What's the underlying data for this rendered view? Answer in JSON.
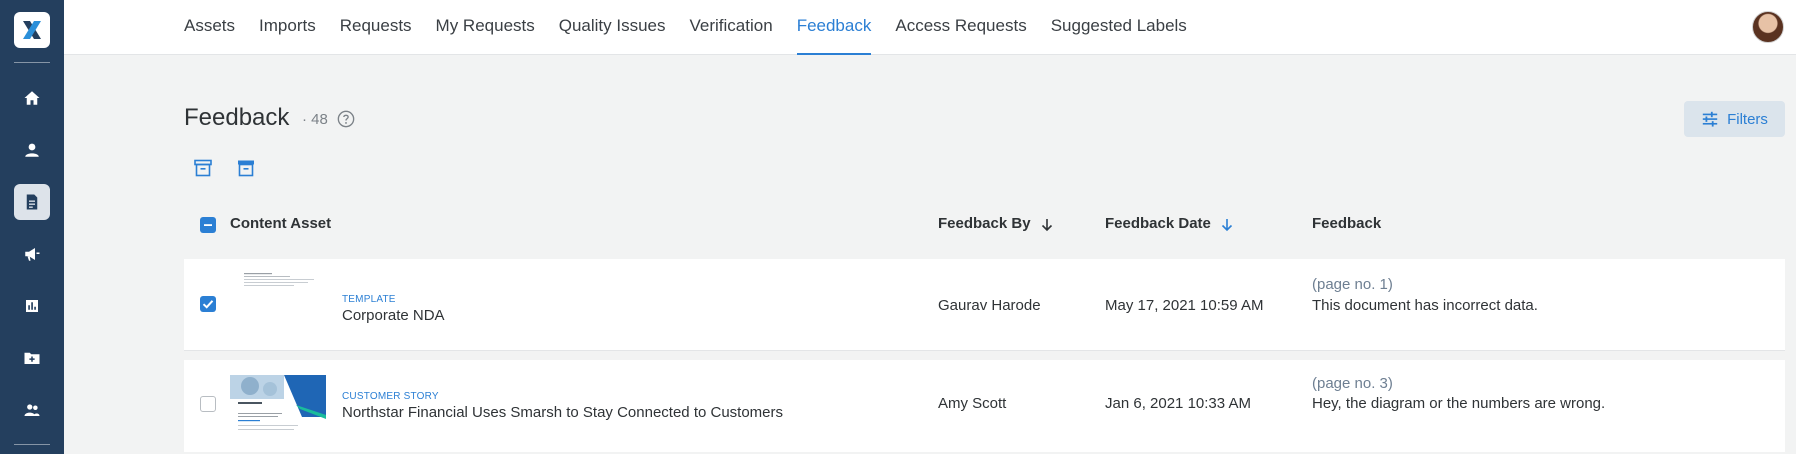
{
  "nav": {
    "tabs": [
      {
        "label": "Assets"
      },
      {
        "label": "Imports"
      },
      {
        "label": "Requests"
      },
      {
        "label": "My Requests"
      },
      {
        "label": "Quality Issues"
      },
      {
        "label": "Verification"
      },
      {
        "label": "Feedback",
        "active": true
      },
      {
        "label": "Access Requests"
      },
      {
        "label": "Suggested Labels"
      }
    ]
  },
  "sidebar": {
    "items": [
      {
        "icon": "home-icon"
      },
      {
        "icon": "user-icon"
      },
      {
        "icon": "document-icon",
        "active": true
      },
      {
        "icon": "megaphone-icon"
      },
      {
        "icon": "bar-chart-icon"
      },
      {
        "icon": "folder-add-icon"
      },
      {
        "icon": "team-icon"
      }
    ]
  },
  "page": {
    "title": "Feedback",
    "count": "· 48",
    "filters_label": "Filters"
  },
  "table": {
    "columns": [
      "Content Asset",
      "Feedback By",
      "Feedback Date",
      "Feedback"
    ],
    "rows": [
      {
        "checked": true,
        "asset_type": "TEMPLATE",
        "asset_title": "Corporate NDA",
        "feedback_by": "Gaurav Harode",
        "feedback_date": "May 17, 2021 10:59 AM",
        "page_ref": "(page no. 1)",
        "feedback": "This document has incorrect data."
      },
      {
        "checked": false,
        "asset_type": "CUSTOMER STORY",
        "asset_title": "Northstar Financial Uses Smarsh to Stay Connected to Customers",
        "feedback_by": "Amy Scott",
        "feedback_date": "Jan 6, 2021 10:33 AM",
        "page_ref": "(page no. 3)",
        "feedback": "Hey, the diagram or the numbers are wrong."
      }
    ]
  },
  "colors": {
    "sidebar": "#243f5e",
    "accent": "#2b7fd4"
  }
}
